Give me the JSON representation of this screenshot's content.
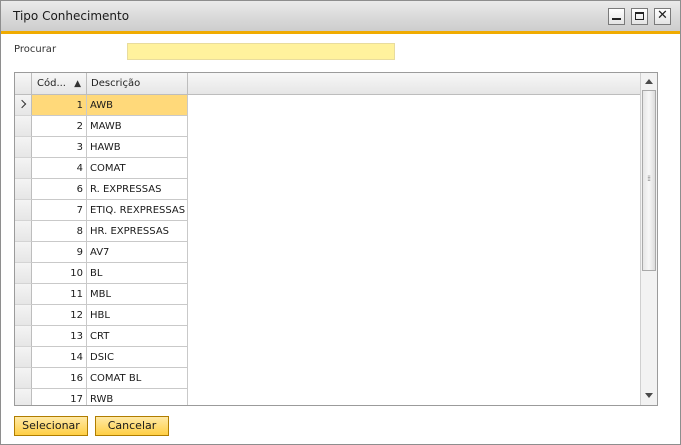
{
  "window": {
    "title": "Tipo Conhecimento",
    "controls": {
      "minimize": "minimize-icon",
      "maximize": "maximize-icon",
      "close_glyph": "✕"
    }
  },
  "search": {
    "label": "Procurar",
    "value": ""
  },
  "grid": {
    "columns": {
      "code": "Cód...",
      "description": "Descrição"
    },
    "sort_indicator": "▲",
    "rows": [
      {
        "code": "1",
        "description": "AWB"
      },
      {
        "code": "2",
        "description": "MAWB"
      },
      {
        "code": "3",
        "description": "HAWB"
      },
      {
        "code": "4",
        "description": "COMAT"
      },
      {
        "code": "6",
        "description": "R. EXPRESSAS"
      },
      {
        "code": "7",
        "description": "ETIQ. REXPRESSAS"
      },
      {
        "code": "8",
        "description": "HR. EXPRESSAS"
      },
      {
        "code": "9",
        "description": "AV7"
      },
      {
        "code": "10",
        "description": "BL"
      },
      {
        "code": "11",
        "description": "MBL"
      },
      {
        "code": "12",
        "description": "HBL"
      },
      {
        "code": "13",
        "description": "CRT"
      },
      {
        "code": "14",
        "description": "DSIC"
      },
      {
        "code": "16",
        "description": "COMAT BL"
      },
      {
        "code": "17",
        "description": "RWB"
      }
    ],
    "selected_index": 0
  },
  "buttons": {
    "select": "Selecionar",
    "cancel": "Cancelar"
  },
  "colors": {
    "accent": "#f0ab00",
    "selected_row": "#ffd97a",
    "search_field": "#fff29d",
    "button": "#ffcf45"
  }
}
